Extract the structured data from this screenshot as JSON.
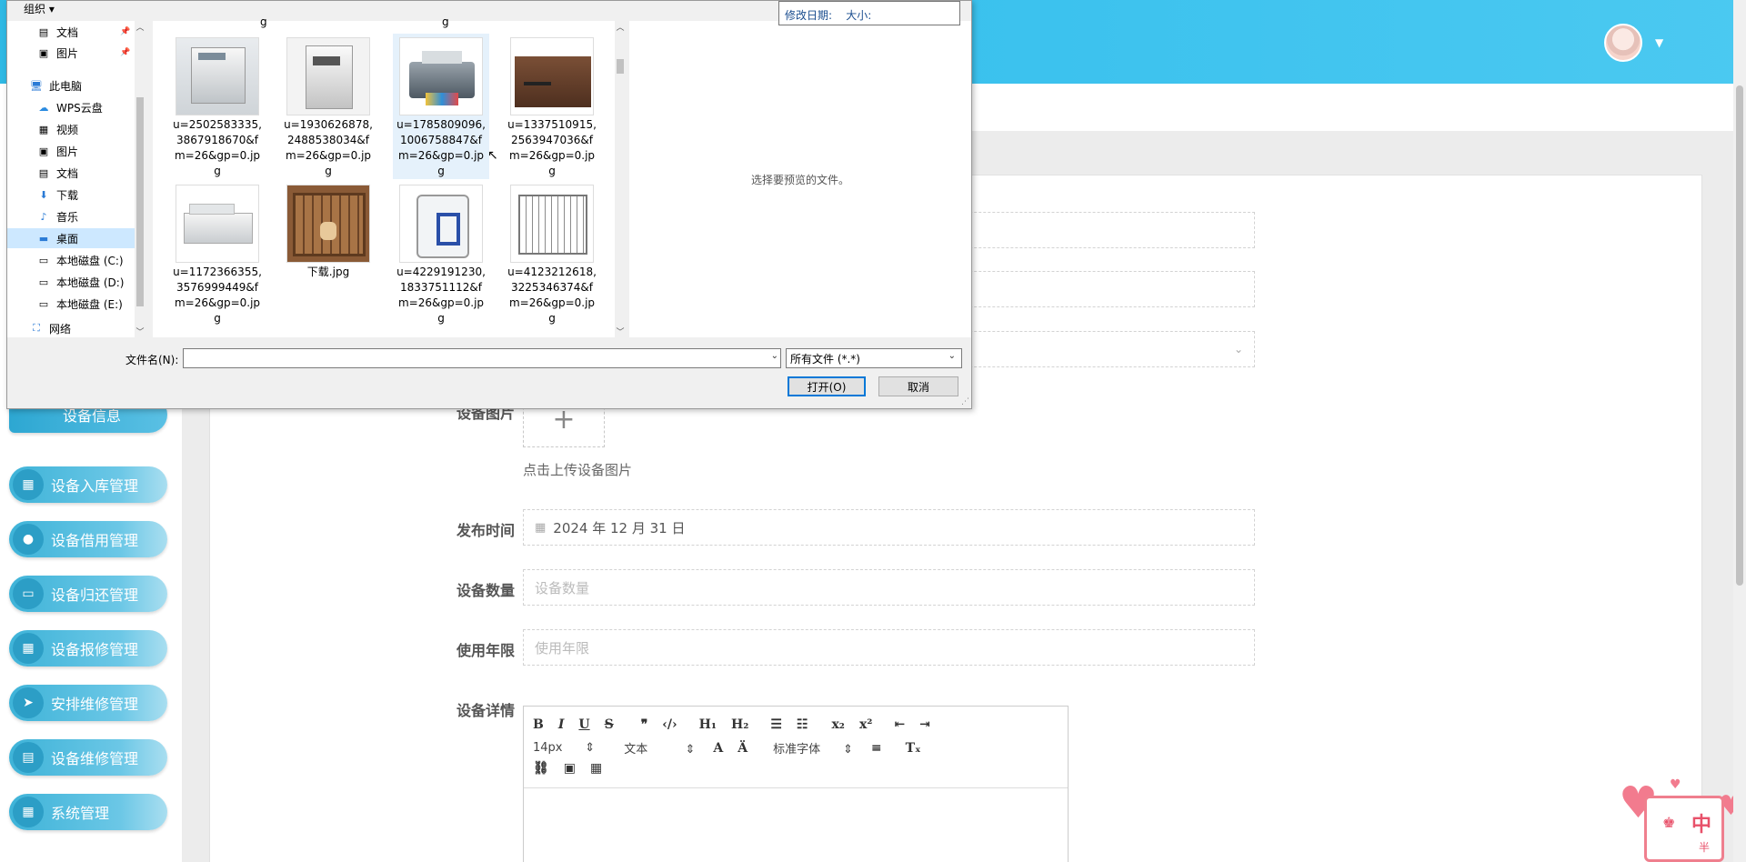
{
  "app": {
    "sidebar": [
      {
        "label": "设备信息",
        "icon": "info-icon",
        "active": true
      },
      {
        "label": "设备入库管理",
        "icon": "grid-icon"
      },
      {
        "label": "设备借用管理",
        "icon": "bulb-icon"
      },
      {
        "label": "设备归还管理",
        "icon": "monitor-icon"
      },
      {
        "label": "设备报修管理",
        "icon": "grid-icon"
      },
      {
        "label": "安排维修管理",
        "icon": "send-icon"
      },
      {
        "label": "设备维修管理",
        "icon": "clipboard-icon"
      },
      {
        "label": "系统管理",
        "icon": "grid-icon"
      }
    ],
    "form": {
      "image_label": "设备图片",
      "upload_hint": "点击上传设备图片",
      "date_label": "发布时间",
      "date_value": "2024 年 12 月 31 日",
      "qty_label": "设备数量",
      "qty_placeholder": "设备数量",
      "years_label": "使用年限",
      "years_placeholder": "使用年限",
      "detail_label": "设备详情"
    },
    "editor": {
      "font_size": "14px",
      "block_type": "文本",
      "font_family": "标准字体"
    },
    "mascot_text": "中",
    "mascot_sub": "半"
  },
  "dialog": {
    "organize": "组织",
    "tooltip": "修改日期:    大小:",
    "tree": [
      {
        "label": "文档",
        "icon": "document-icon",
        "pinned": true
      },
      {
        "label": "图片",
        "icon": "picture-icon",
        "pinned": true
      },
      {
        "label": "此电脑",
        "icon": "computer-icon"
      },
      {
        "label": "WPS云盘",
        "icon": "cloud-icon"
      },
      {
        "label": "视频",
        "icon": "video-icon"
      },
      {
        "label": "图片",
        "icon": "picture-icon"
      },
      {
        "label": "文档",
        "icon": "document-icon"
      },
      {
        "label": "下载",
        "icon": "download-icon"
      },
      {
        "label": "音乐",
        "icon": "music-icon"
      },
      {
        "label": "桌面",
        "icon": "desktop-icon",
        "selected": true
      },
      {
        "label": "本地磁盘 (C:)",
        "icon": "drive-icon"
      },
      {
        "label": "本地磁盘 (D:)",
        "icon": "drive-icon"
      },
      {
        "label": "本地磁盘 (E:)",
        "icon": "drive-icon"
      },
      {
        "label": "网络",
        "icon": "network-icon"
      }
    ],
    "files": [
      {
        "name": "u=2502583335,3867918670&fm=26&gp=0.jpg",
        "thumb": "copier"
      },
      {
        "name": "u=1930626878,2488538034&fm=26&gp=0.jpg",
        "thumb": "copier2"
      },
      {
        "name": "u=1785809096,1006758847&fm=26&gp=0.jpg",
        "thumb": "printer",
        "selected": true
      },
      {
        "name": "u=1337510915,2563947036&fm=26&gp=0.jpg",
        "thumb": "desk"
      },
      {
        "name": "u=1172366355,3576999449&fm=26&gp=0.jpg",
        "thumb": "scanner"
      },
      {
        "name": "下载.jpg",
        "thumb": "crate"
      },
      {
        "name": "u=4229191230,1833751112&fm=26&gp=0.jpg",
        "thumb": "box"
      },
      {
        "name": "u=4123212618,3225346374&fm=26&gp=0.jpg",
        "thumb": "cage"
      }
    ],
    "top_partial": [
      "g",
      "g"
    ],
    "preview_text": "选择要预览的文件。",
    "filename_label": "文件名(N):",
    "filename_value": "",
    "filter_value": "所有文件 (*.*)",
    "open_label": "打开(O)",
    "cancel_label": "取消"
  }
}
